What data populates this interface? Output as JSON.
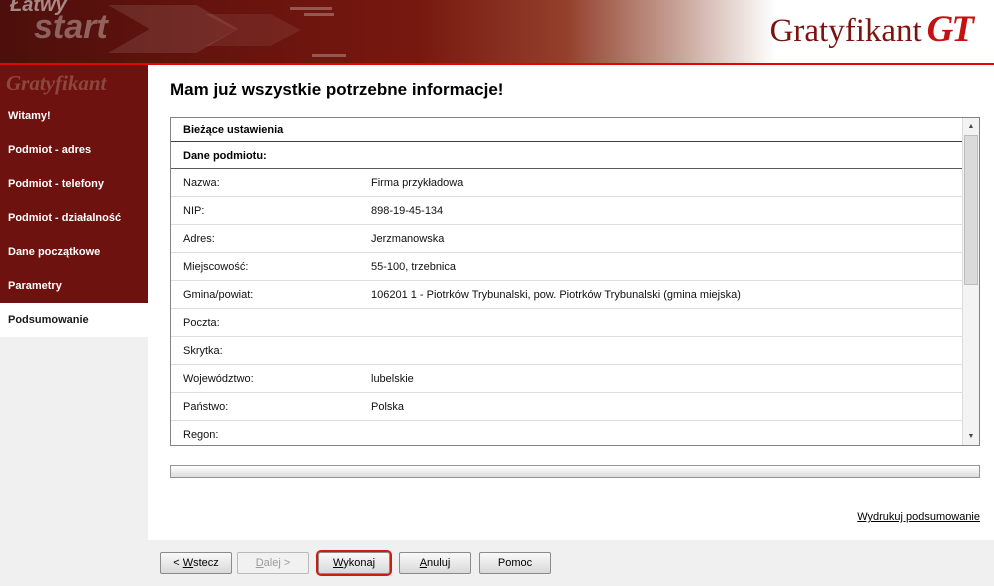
{
  "header": {
    "watermark": {
      "line1": "Łatwy",
      "line2": "start",
      "brand": "Gratyfikant"
    },
    "logo": {
      "name": "Gratyfikant",
      "suffix": "GT"
    }
  },
  "sidebar": {
    "items": [
      {
        "label": "Witamy!",
        "active": false
      },
      {
        "label": "Podmiot - adres",
        "active": false
      },
      {
        "label": "Podmiot - telefony",
        "active": false
      },
      {
        "label": "Podmiot - działalność",
        "active": false
      },
      {
        "label": "Dane początkowe",
        "active": false
      },
      {
        "label": "Parametry",
        "active": false
      },
      {
        "label": "Podsumowanie",
        "active": true
      }
    ]
  },
  "main": {
    "title": "Mam już wszystkie potrzebne informacje!",
    "panel": {
      "header": "Bieżące ustawienia",
      "section": "Dane podmiotu:",
      "rows": [
        {
          "label": "Nazwa:",
          "value": "Firma przykładowa"
        },
        {
          "label": "NIP:",
          "value": "898-19-45-134"
        },
        {
          "label": "Adres:",
          "value": "Jerzmanowska"
        },
        {
          "label": "Miejscowość:",
          "value": "55-100, trzebnica"
        },
        {
          "label": "Gmina/powiat:",
          "value": "106201 1 - Piotrków Trybunalski, pow. Piotrków Trybunalski (gmina miejska)"
        },
        {
          "label": "Poczta:",
          "value": ""
        },
        {
          "label": "Skrytka:",
          "value": ""
        },
        {
          "label": "Województwo:",
          "value": "lubelskie"
        },
        {
          "label": "Państwo:",
          "value": "Polska"
        },
        {
          "label": "Regon:",
          "value": ""
        }
      ],
      "scrollbar": {
        "up_icon": "▲",
        "down_icon": "▼"
      }
    },
    "print_link": "Wydrukuj podsumowanie"
  },
  "footer": {
    "buttons": [
      {
        "name": "wstecz",
        "pre": "< ",
        "mn": "W",
        "post": "stecz",
        "state": "enabled"
      },
      {
        "name": "dalej",
        "pre": "",
        "mn": "D",
        "post": "alej >",
        "state": "disabled"
      },
      {
        "name": "wykonaj",
        "pre": "",
        "mn": "W",
        "post": "ykonaj",
        "state": "default-focused"
      },
      {
        "name": "anuluj",
        "pre": "",
        "mn": "A",
        "post": "nuluj",
        "state": "enabled"
      },
      {
        "name": "pomoc",
        "pre": "Pomoc",
        "mn": "",
        "post": "",
        "state": "enabled"
      }
    ]
  },
  "colors": {
    "header_maroon": "#6d120e",
    "accent_line": "#e30505",
    "logo_red": "#c41212",
    "focus_ring": "#cf1b10"
  }
}
